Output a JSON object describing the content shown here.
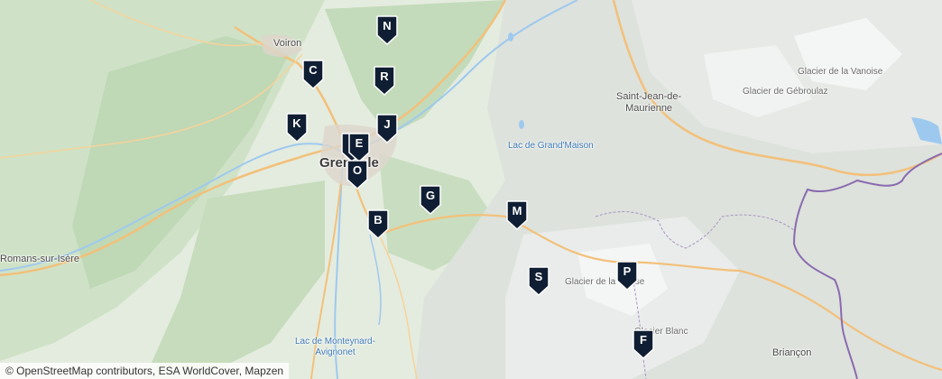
{
  "map": {
    "colors": {
      "land": "#e4ecdf",
      "forest": "#c7dcbf",
      "mountain": "#d9ddd8",
      "snow": "#f4f6f5",
      "road": "#f6c778",
      "water": "#9ec9ef",
      "border": "#8a6bb0",
      "marker": "#0f1e33"
    },
    "places": [
      {
        "key": "voiron",
        "name": "Voiron",
        "kind": "town"
      },
      {
        "key": "grenoble",
        "name": "Grenoble",
        "kind": "city"
      },
      {
        "key": "romans",
        "name": "Romans-sur-Isère",
        "kind": "town"
      },
      {
        "key": "sjm",
        "name": "Saint-Jean-de-\nMaurienne",
        "kind": "town"
      },
      {
        "key": "vanoise",
        "name": "Glacier de la Vanoise",
        "kind": "glacier"
      },
      {
        "key": "gebroulaz",
        "name": "Glacier de Gébroulaz",
        "kind": "glacier"
      },
      {
        "key": "grandmaison",
        "name": "Lac de Grand'Maison",
        "kind": "water"
      },
      {
        "key": "girose",
        "name": "Glacier de la Girose",
        "kind": "glacier"
      },
      {
        "key": "blanc",
        "name": "Glacier Blanc",
        "kind": "glacier"
      },
      {
        "key": "monteynard",
        "name": "Lac de Monteynard-\nAvignonet",
        "kind": "water"
      },
      {
        "key": "briancon",
        "name": "Briançon",
        "kind": "town"
      }
    ],
    "markers": [
      {
        "label": "N"
      },
      {
        "label": "C"
      },
      {
        "label": "R"
      },
      {
        "label": "K"
      },
      {
        "label": "J"
      },
      {
        "label": "I"
      },
      {
        "label": "E"
      },
      {
        "label": "O"
      },
      {
        "label": "G"
      },
      {
        "label": "B"
      },
      {
        "label": "M"
      },
      {
        "label": "S"
      },
      {
        "label": "P"
      },
      {
        "label": "F"
      }
    ],
    "attribution": "© OpenStreetMap contributors, ESA WorldCover, Mapzen"
  }
}
